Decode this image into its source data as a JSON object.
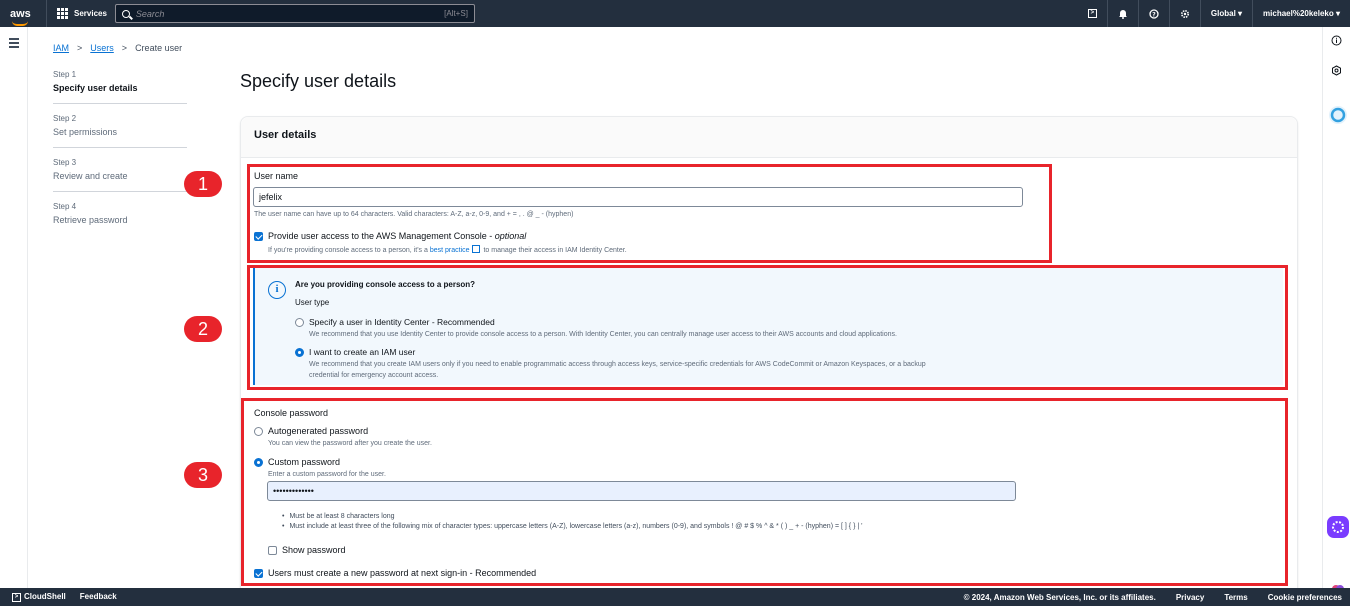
{
  "topbar": {
    "logo": "aws",
    "services": "Services",
    "search_placeholder": "Search",
    "search_shortcut": "[Alt+S]",
    "region": "Global ▾",
    "account": "michael%20keleko ▾"
  },
  "breadcrumb": {
    "iam": "IAM",
    "users": "Users",
    "current": "Create user",
    "sep": ">"
  },
  "steps": [
    {
      "num": "Step 1",
      "label": "Specify user details"
    },
    {
      "num": "Step 2",
      "label": "Set permissions"
    },
    {
      "num": "Step 3",
      "label": "Review and create"
    },
    {
      "num": "Step 4",
      "label": "Retrieve password"
    }
  ],
  "page_title": "Specify user details",
  "panel_title": "User details",
  "user_name": {
    "label": "User name",
    "value": "jefelix",
    "hint": "The user name can have up to 64 characters. Valid characters: A-Z, a-z, 0-9, and + = , . @ _ - (hyphen)"
  },
  "console_access": {
    "label": "Provide user access to the AWS Management Console - ",
    "optional": "optional",
    "hint_pre": "If you're providing console access to a person, it's a ",
    "hint_link": "best practice",
    "hint_post": " to manage their access in IAM Identity Center.",
    "checked": true
  },
  "info": {
    "title": "Are you providing console access to a person?",
    "user_type": "User type",
    "opt1_label": "Specify a user in Identity Center - Recommended",
    "opt1_desc": "We recommend that you use Identity Center to provide console access to a person. With Identity Center, you can centrally manage user access to their AWS accounts and cloud applications.",
    "opt2_label": "I want to create an IAM user",
    "opt2_desc1": "We recommend that you create IAM users only if you need to enable programmatic access through access keys, service-specific credentials for AWS CodeCommit or Amazon Keyspaces, or a backup",
    "opt2_desc2": "credential for emergency account access.",
    "selected": "opt2"
  },
  "password": {
    "label": "Console password",
    "auto_label": "Autogenerated password",
    "auto_desc": "You can view the password after you create the user.",
    "custom_label": "Custom password",
    "custom_desc": "Enter a custom password for the user.",
    "value": "•••••••••••••",
    "rule1": "Must be at least 8 characters long",
    "rule2": "Must include at least three of the following mix of character types: uppercase letters (A-Z), lowercase letters (a-z), numbers (0-9), and symbols ! @ # $ % ^ & * ( ) _ + - (hyphen) = [ ] { } | '",
    "show": "Show password",
    "reset": "Users must create a new password at next sign-in - Recommended",
    "selected": "custom"
  },
  "badges": [
    "1",
    "2",
    "3"
  ],
  "footer": {
    "cloudshell": "CloudShell",
    "feedback": "Feedback",
    "copyright": "© 2024, Amazon Web Services, Inc. or its affiliates.",
    "privacy": "Privacy",
    "terms": "Terms",
    "cookie": "Cookie preferences"
  },
  "colors": {
    "accent": "#0972d3",
    "annotation": "#e8242b",
    "nav": "#232f3e"
  }
}
